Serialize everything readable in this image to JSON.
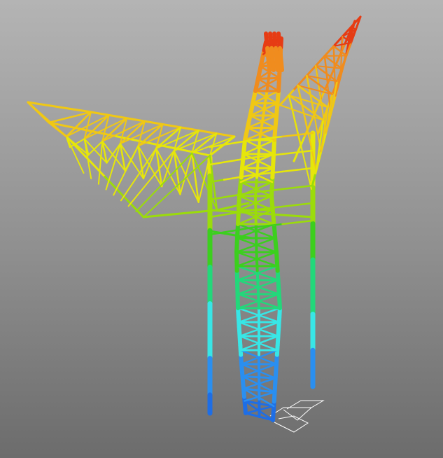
{
  "viewport": {
    "background_top": "#b4b4b4",
    "background_bottom": "#6c6c6c",
    "contour_legend_visible": false
  },
  "contour_palette": [
    "#1e6ee6",
    "#2a8ff0",
    "#38e6e6",
    "#22d87a",
    "#3ccf1e",
    "#9bdc0a",
    "#e6e60a",
    "#f0c814",
    "#f08c1e",
    "#e63c14"
  ],
  "structure": {
    "kind": "lattice truss tower with cantilever arms",
    "deformed_shape": true,
    "undeformed_outline_color": "#ffffff"
  }
}
